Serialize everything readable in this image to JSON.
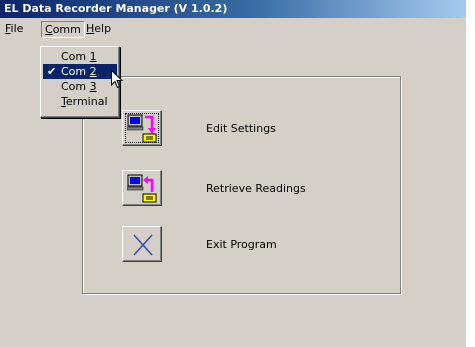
{
  "window": {
    "title": "EL Data Recorder Manager (V 1.0.2)"
  },
  "menubar": {
    "file": {
      "before": "",
      "mnemonic": "F",
      "after": "ile"
    },
    "comm": {
      "before": "",
      "mnemonic": "C",
      "after": "omm"
    },
    "help": {
      "before": "",
      "mnemonic": "H",
      "after": "elp"
    }
  },
  "comm_menu": {
    "items": [
      {
        "before": "Com ",
        "mnemonic": "1",
        "after": "",
        "checked": false
      },
      {
        "before": "Com ",
        "mnemonic": "2",
        "after": "",
        "checked": true
      },
      {
        "before": "Com ",
        "mnemonic": "3",
        "after": "",
        "checked": false
      },
      {
        "before": "",
        "mnemonic": "T",
        "after": "erminal",
        "checked": false
      }
    ],
    "check_glyph": "✔"
  },
  "actions": {
    "edit_settings": {
      "label": "Edit Settings",
      "icon": "computer-to-recorder-icon"
    },
    "retrieve_readings": {
      "label": "Retrieve Readings",
      "icon": "recorder-to-computer-icon"
    },
    "exit_program": {
      "label": "Exit Program",
      "icon": "close-x-icon"
    }
  },
  "colors": {
    "titlebar_start": "#0a246a",
    "titlebar_end": "#a6caf0",
    "menu_highlight": "#0a246a",
    "arrow_magenta": "#ff00ff",
    "exit_x": "#3a4fb0"
  }
}
